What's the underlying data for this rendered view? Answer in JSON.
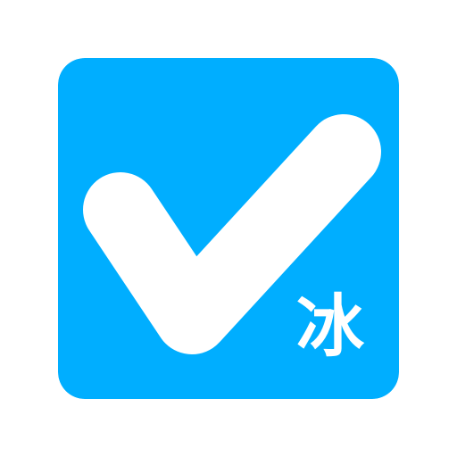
{
  "icon": {
    "name": "checkmark-icon",
    "background_color": "#00AEFF",
    "foreground_color": "#FFFFFF"
  },
  "badge": {
    "char": "冰"
  }
}
